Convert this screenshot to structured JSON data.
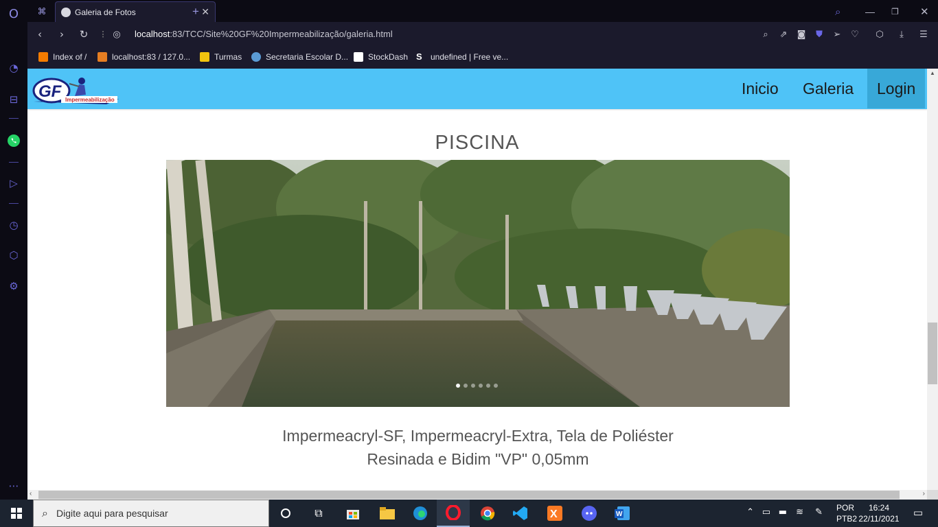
{
  "browser": {
    "tab_title": "Galeria de Fotos",
    "url_host": "localhost",
    "url_rest": ":83/TCC/Site%20GF%20Impermeabilização/galeria.html",
    "bookmarks": [
      {
        "label": "Index of /",
        "color": "#f57c00"
      },
      {
        "label": "localhost:83 / 127.0...",
        "color": "#e67e22"
      },
      {
        "label": "Turmas",
        "color": "#f1c40f"
      },
      {
        "label": "Secretaria Escolar D...",
        "color": "#5b9bd5"
      },
      {
        "label": "StockDash",
        "color": "#ffffff"
      },
      {
        "label": "undefined | Free ve...",
        "color": "#ffffff"
      }
    ]
  },
  "site": {
    "logo_text": "GF",
    "logo_subtext": "Impermeabilização",
    "nav": {
      "inicio": "Inicio",
      "galeria": "Galeria",
      "login": "Login"
    },
    "accent": "#4fc3f7",
    "gallery_title": "PISCINA",
    "caption_line1": "Impermeacryl-SF, Impermeacryl-Extra, Tela de Poliéster",
    "caption_line2": "Resinada e Bidim \"VP\" 0,05mm",
    "carousel_total": 6,
    "carousel_active": 1
  },
  "taskbar": {
    "search_placeholder": "Digite aqui para pesquisar",
    "lang1": "POR",
    "lang2": "PTB2",
    "time": "16:24",
    "date": "22/11/2021"
  }
}
